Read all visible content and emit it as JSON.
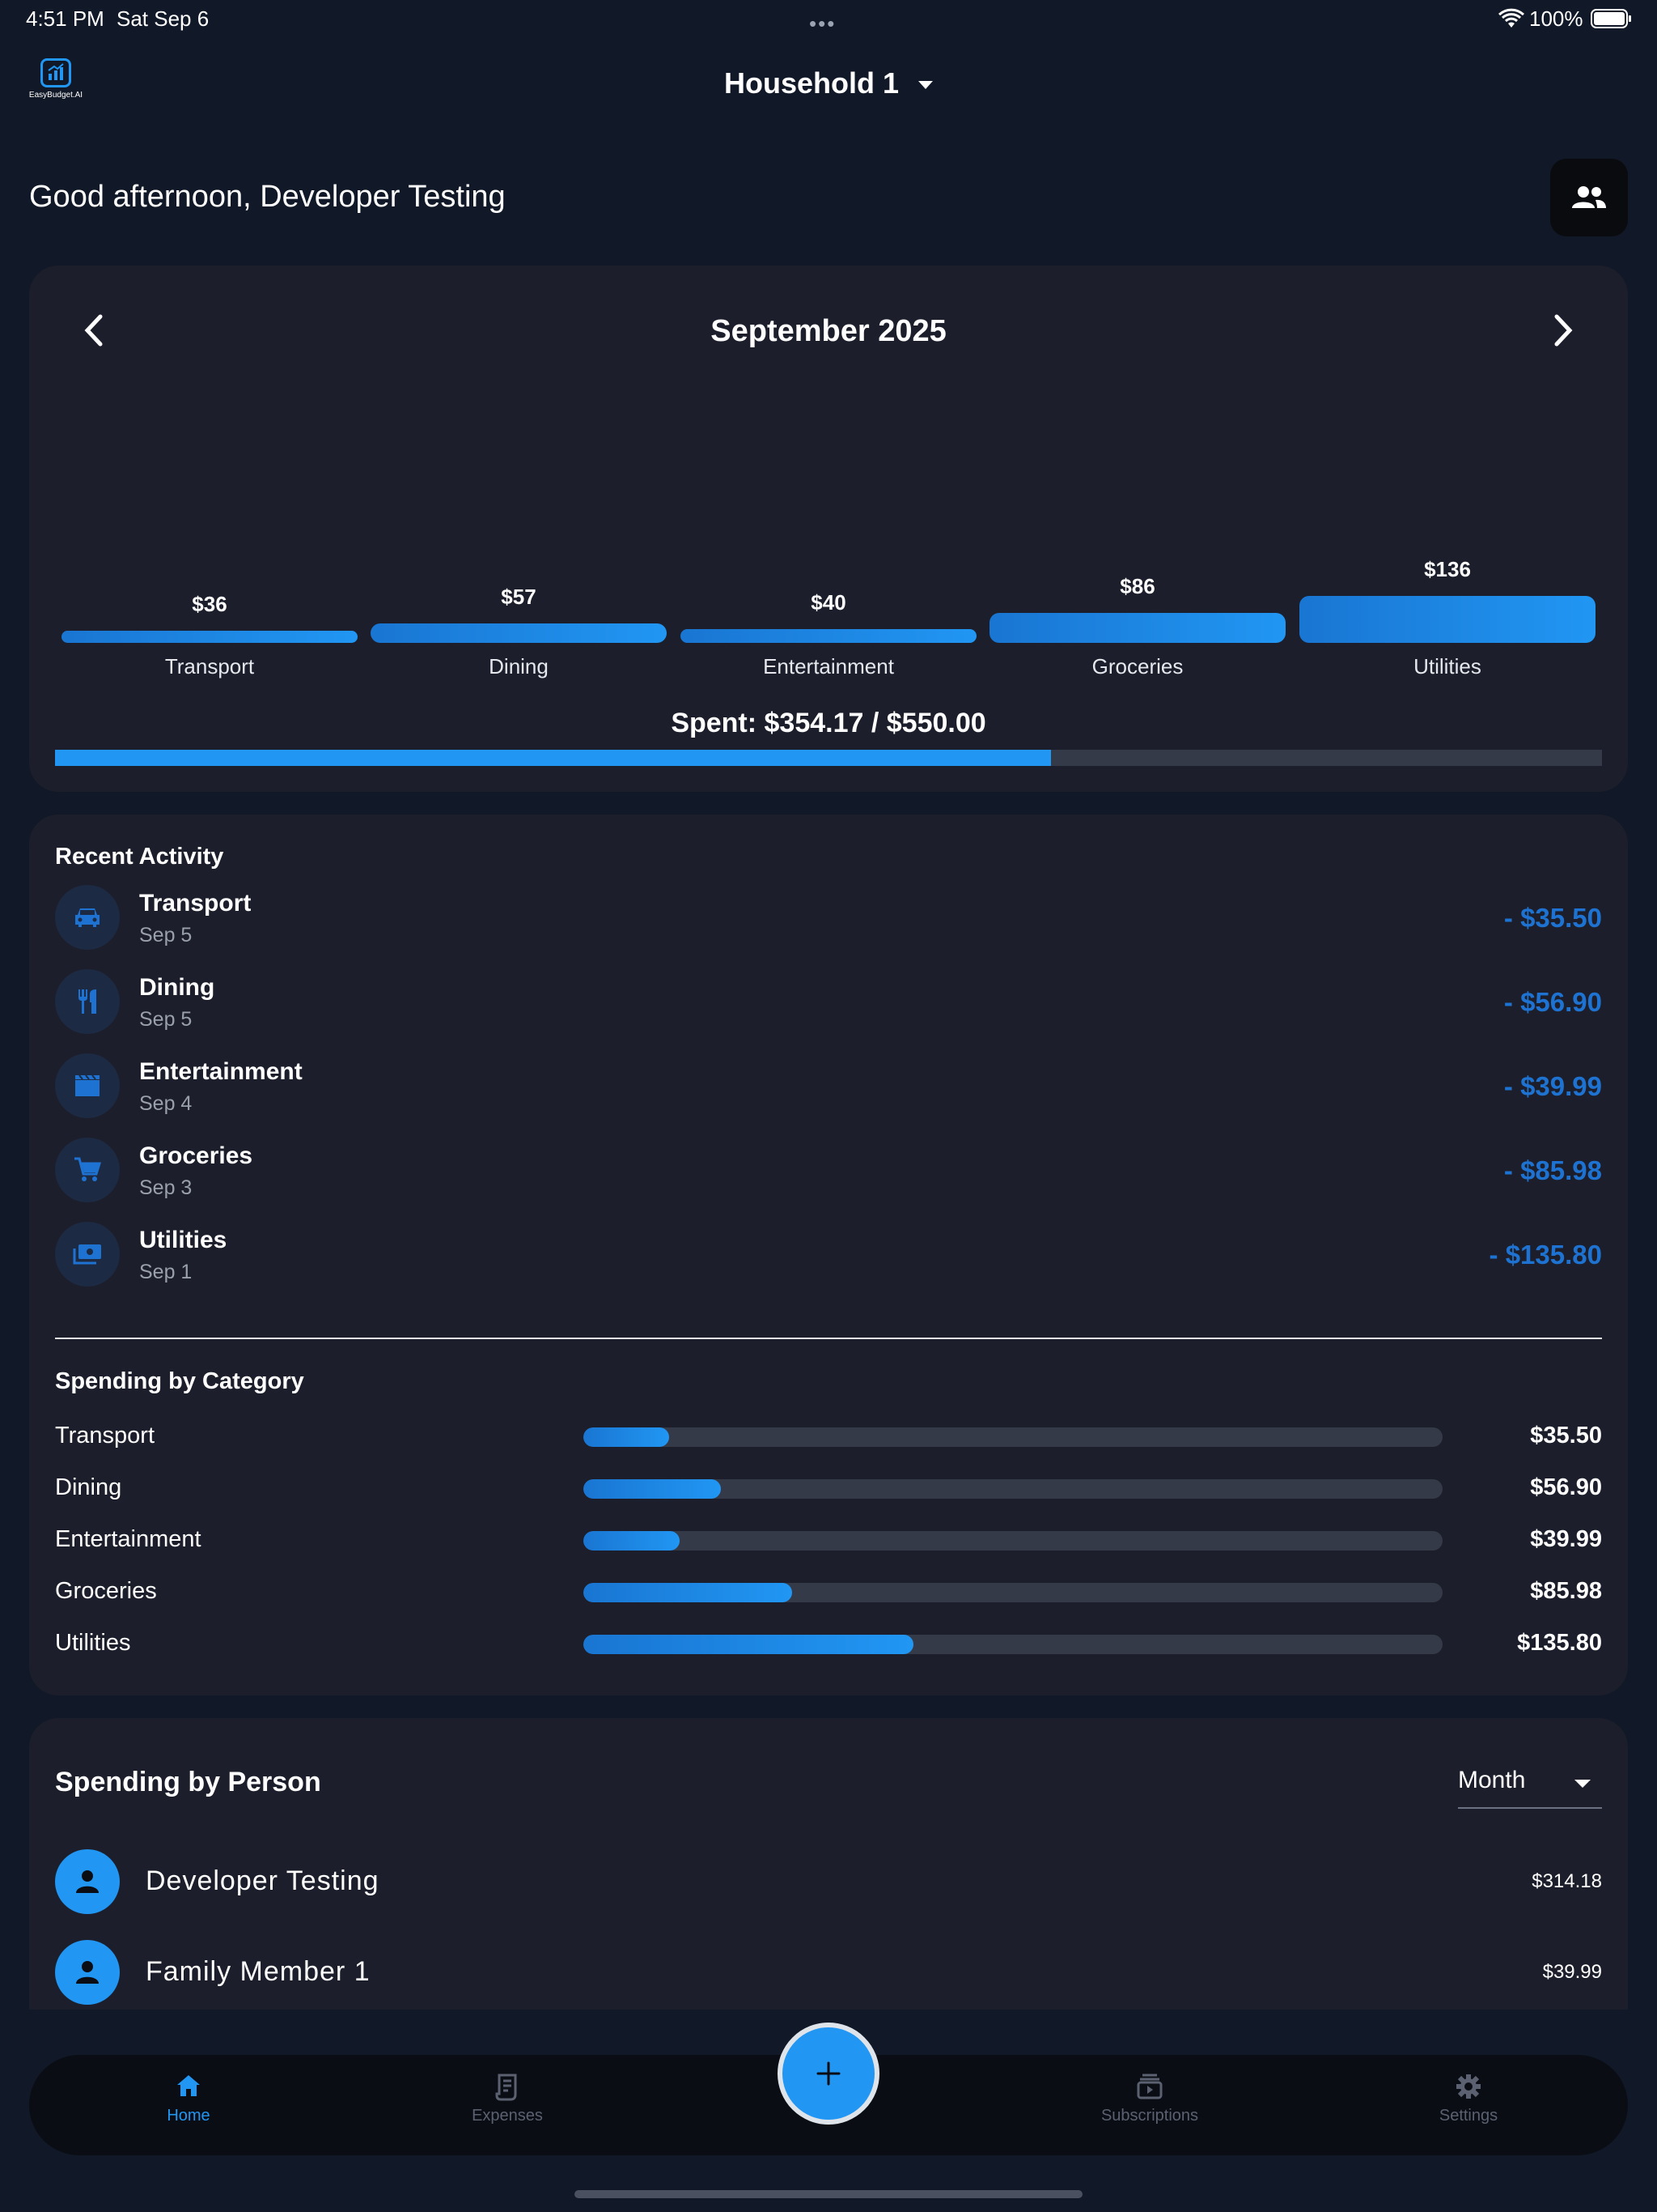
{
  "status_bar": {
    "time": "4:51 PM",
    "date": "Sat Sep 6",
    "battery": "100%"
  },
  "header": {
    "logo_text": "EasyBudget.AI",
    "household": "Household 1",
    "greeting": "Good afternoon, Developer Testing"
  },
  "overview": {
    "month": "September 2025",
    "spent_label": "Spent: $354.17 / $550.00",
    "spent_fraction": 0.644
  },
  "chart_data": {
    "type": "bar",
    "categories": [
      "Transport",
      "Dining",
      "Entertainment",
      "Groceries",
      "Utilities"
    ],
    "values": [
      36,
      57,
      40,
      86,
      136
    ],
    "value_labels": [
      "$36",
      "$57",
      "$40",
      "$86",
      "$136"
    ]
  },
  "recent_activity": {
    "title": "Recent Activity",
    "items": [
      {
        "name": "Transport",
        "date": "Sep 5",
        "amount": "- $35.50",
        "icon": "car-icon"
      },
      {
        "name": "Dining",
        "date": "Sep 5",
        "amount": "- $56.90",
        "icon": "utensils-icon"
      },
      {
        "name": "Entertainment",
        "date": "Sep 4",
        "amount": "- $39.99",
        "icon": "clapperboard-icon"
      },
      {
        "name": "Groceries",
        "date": "Sep 3",
        "amount": "- $85.98",
        "icon": "cart-icon"
      },
      {
        "name": "Utilities",
        "date": "Sep 1",
        "amount": "- $135.80",
        "icon": "money-icon"
      }
    ]
  },
  "spending_by_category": {
    "title": "Spending by Category",
    "items": [
      {
        "name": "Transport",
        "amount": "$35.50",
        "fraction": 0.1
      },
      {
        "name": "Dining",
        "amount": "$56.90",
        "fraction": 0.16
      },
      {
        "name": "Entertainment",
        "amount": "$39.99",
        "fraction": 0.112
      },
      {
        "name": "Groceries",
        "amount": "$85.98",
        "fraction": 0.243
      },
      {
        "name": "Utilities",
        "amount": "$135.80",
        "fraction": 0.384
      }
    ]
  },
  "spending_by_person": {
    "title": "Spending by Person",
    "period": "Month",
    "people": [
      {
        "name": "Developer Testing",
        "amount": "$314.18"
      },
      {
        "name": "Family Member 1",
        "amount": "$39.99"
      }
    ]
  },
  "tabs": [
    {
      "label": "Home",
      "icon": "home-icon",
      "active": true
    },
    {
      "label": "Expenses",
      "icon": "receipt-icon",
      "active": false
    },
    {
      "label": "Subscriptions",
      "icon": "subscriptions-icon",
      "active": false
    },
    {
      "label": "Settings",
      "icon": "gear-icon",
      "active": false
    }
  ],
  "colors": {
    "accent": "#2196f3",
    "amount": "#1e73d2",
    "background": "#111827",
    "card": "#1c1f2b"
  }
}
